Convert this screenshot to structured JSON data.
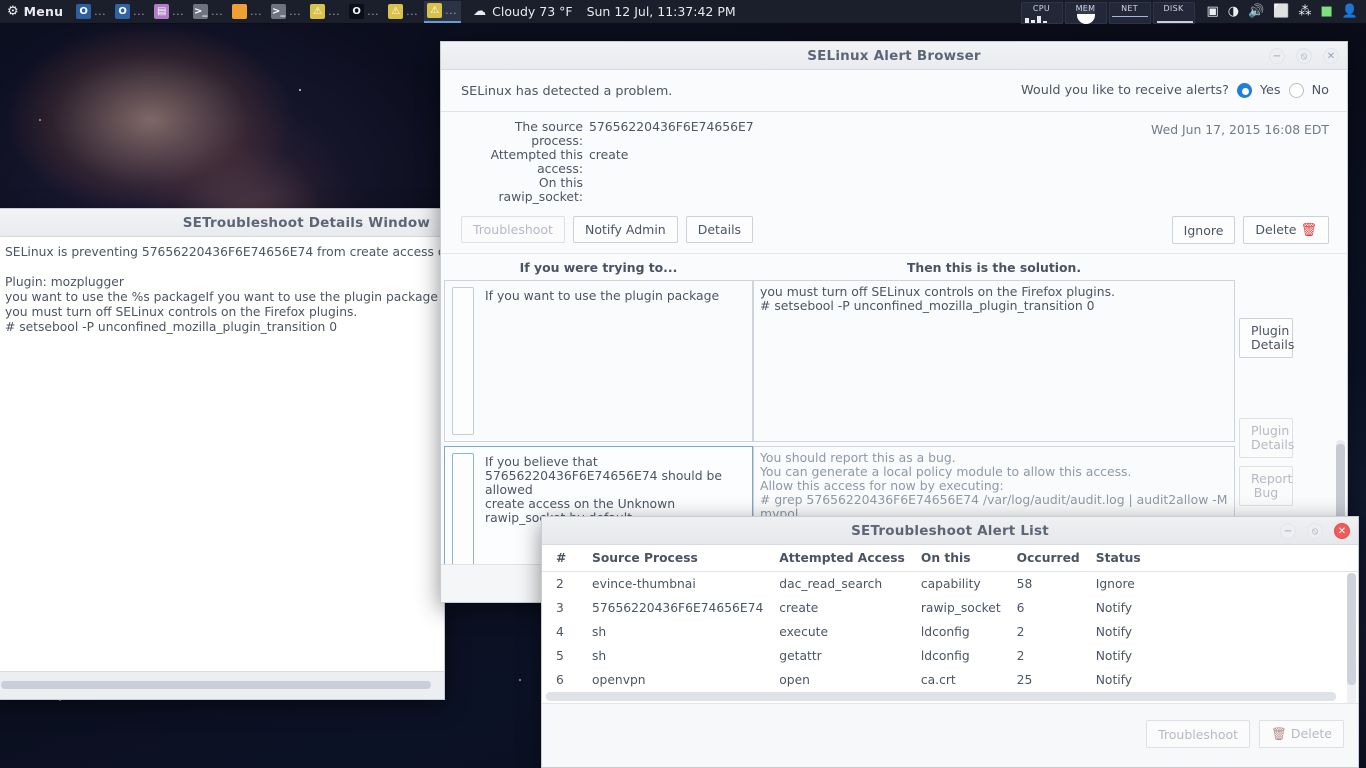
{
  "panel": {
    "menu": {
      "label": "Menu",
      "icon": "gear-icon"
    },
    "tasks": [
      {
        "icon": "app-icon-blue",
        "glyph": "O",
        "label": "..."
      },
      {
        "icon": "app-icon-blue",
        "glyph": "O",
        "label": "..."
      },
      {
        "icon": "app-icon-purple",
        "glyph": "B",
        "label": "..."
      },
      {
        "icon": "terminal-icon",
        "glyph": ">_",
        "label": "..."
      },
      {
        "icon": "folder-icon",
        "glyph": "",
        "label": "..."
      },
      {
        "icon": "terminal-icon",
        "glyph": ">_",
        "label": "..."
      },
      {
        "icon": "warning-icon",
        "glyph": "",
        "label": "..."
      },
      {
        "icon": "opera-icon",
        "glyph": "O",
        "label": "..."
      },
      {
        "icon": "warning-icon",
        "glyph": "",
        "label": "..."
      },
      {
        "icon": "warning-icon",
        "glyph": "",
        "label": "..."
      }
    ],
    "weather": {
      "icon": "cloud-icon",
      "text": "Cloudy 73 °F"
    },
    "clock": "Sun 12 Jul, 11:37:42 PM",
    "monitors": [
      {
        "label": "CPU"
      },
      {
        "label": "MEM"
      },
      {
        "label": "NET"
      },
      {
        "label": "DISK"
      }
    ],
    "tray": [
      {
        "name": "screenshot-icon",
        "glyph": "▣"
      },
      {
        "name": "wifi-icon",
        "glyph": "◑"
      },
      {
        "name": "volume-icon",
        "glyph": "🔊"
      },
      {
        "name": "clipboard-icon",
        "glyph": "⬜"
      },
      {
        "name": "bluetooth-icon",
        "glyph": "⁂"
      },
      {
        "name": "updates-icon",
        "glyph": "■"
      },
      {
        "name": "user-icon",
        "glyph": "👤"
      }
    ]
  },
  "details_window": {
    "title": "SETroubleshoot Details Window",
    "controls": {
      "minimize": "−",
      "maximize": "⦸",
      "close": "✕"
    },
    "body": "SELinux is preventing 57656220436F6E74656E74 from create access on the ra\n\nPlugin: mozplugger\nyou want to use the %s packageIf you want to use the plugin package\nyou must turn off SELinux controls on the Firefox plugins.\n# setsebool -P unconfined_mozilla_plugin_transition 0"
  },
  "alert_browser": {
    "title": "SELinux Alert Browser",
    "controls": {
      "minimize": "−",
      "maximize": "⦸",
      "close": "✕"
    },
    "notice": "SELinux has detected a problem.",
    "alerts_question": "Would you like to receive alerts?",
    "alerts_yes": "Yes",
    "alerts_no": "No",
    "alerts_selected": "Yes",
    "summary": [
      {
        "key": "The source process:",
        "value": "57656220436F6E74656E7"
      },
      {
        "key": "Attempted this access:",
        "value": "create"
      },
      {
        "key": "On this rawip_socket:",
        "value": ""
      }
    ],
    "date": "Wed Jun 17, 2015 16:08 EDT",
    "buttons": {
      "troubleshoot": "Troubleshoot",
      "troubleshoot_disabled": true,
      "notify_admin": "Notify Admin",
      "details": "Details",
      "ignore": "Ignore",
      "delete": "Delete",
      "delete_icon": "trash-icon"
    },
    "columns": {
      "left_header": "If you were trying to...",
      "right_header": "Then this is the solution."
    },
    "rows": [
      {
        "selected": false,
        "trying_to": "If you want to use the plugin package",
        "solution": "you must turn off SELinux controls on the Firefox plugins.\n# setsebool -P unconfined_mozilla_plugin_transition 0",
        "side_button": "Plugin\nDetails",
        "side_button_disabled": false
      },
      {
        "selected": true,
        "trying_to": "If you believe that\n57656220436F6E74656E74 should be allowed\ncreate access on the Unknown\nrawip_socket by default.",
        "solution": "You should report this as a bug.\nYou can generate a local policy module to allow this access.\nAllow this access for now by executing:\n# grep 57656220436F6E74656E74 /var/log/audit/audit.log | audit2allow -M mypol\n# semodule -i mypol.pp",
        "side_button": "Plugin\nDetails",
        "side_button_disabled": true,
        "side_button_2": "Report\nBug",
        "side_button_2_disabled": true
      }
    ]
  },
  "alert_list": {
    "title": "SETroubleshoot Alert List",
    "controls": {
      "minimize": "−",
      "maximize": "⦸",
      "close": "✕"
    },
    "headers": [
      "#",
      "Source Process",
      "Attempted Access",
      "On this",
      "Occurred",
      "Status"
    ],
    "rows": [
      {
        "num": "2",
        "source_process": "evince-thumbnai",
        "attempted_access": "dac_read_search",
        "on_this": "capability",
        "occurred": "58",
        "status": "Ignore"
      },
      {
        "num": "3",
        "source_process": "57656220436F6E74656E74",
        "attempted_access": "create",
        "on_this": "rawip_socket",
        "occurred": "6",
        "status": "Notify"
      },
      {
        "num": "4",
        "source_process": "sh",
        "attempted_access": "execute",
        "on_this": "ldconfig",
        "occurred": "2",
        "status": "Notify"
      },
      {
        "num": "5",
        "source_process": "sh",
        "attempted_access": "getattr",
        "on_this": "ldconfig",
        "occurred": "2",
        "status": "Notify"
      },
      {
        "num": "6",
        "source_process": "openvpn",
        "attempted_access": "open",
        "on_this": "ca.crt",
        "occurred": "25",
        "status": "Notify"
      }
    ],
    "footer_buttons": {
      "troubleshoot": "Troubleshoot",
      "troubleshoot_disabled": true,
      "delete": "Delete",
      "delete_icon": "trash-icon"
    }
  },
  "colors": {
    "accent_blue": "#1f7fe0",
    "close_red": "#f05b5b",
    "trash_red": "#e03b3b",
    "panel_bg": "#1b1f2b",
    "title_text": "#5d6677"
  }
}
